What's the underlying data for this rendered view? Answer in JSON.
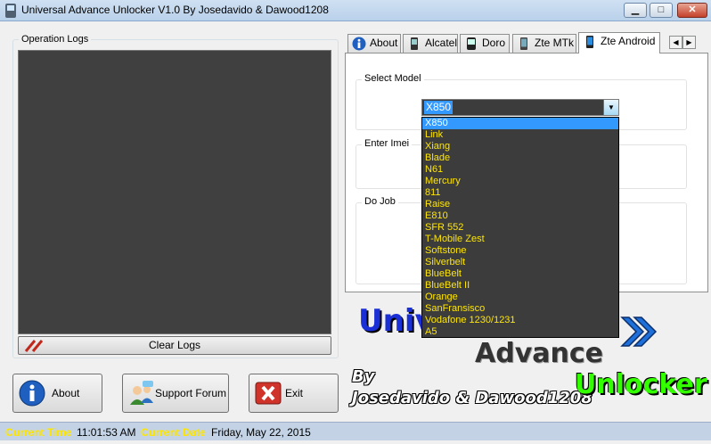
{
  "window": {
    "title": "Universal Advance Unlocker V1.0 By Josedavido & Dawood1208"
  },
  "logs": {
    "group_label": "Operation Logs",
    "clear_label": "Clear Logs"
  },
  "buttons": {
    "about": "About",
    "forum": "Support Forum",
    "exit": "Exit"
  },
  "status": {
    "time_label": "Current Time",
    "time_value": "11:01:53 AM",
    "date_label": "Current Date",
    "date_value": "Friday, May 22, 2015"
  },
  "tabs": [
    {
      "label": "About",
      "icon": "info-icon"
    },
    {
      "label": "Alcatel",
      "icon": "phone-icon"
    },
    {
      "label": "Doro",
      "icon": "phone-icon"
    },
    {
      "label": "Zte MTk",
      "icon": "phone-icon"
    },
    {
      "label": "Zte Android",
      "icon": "phone-icon",
      "active": true
    }
  ],
  "panel": {
    "select_model_label": "Select Model",
    "enter_imei_label": "Enter Imei",
    "do_job_label": "Do Job",
    "model_selected": "X850",
    "model_options": [
      "X850",
      "Link",
      "Xiang",
      "Blade",
      "N61",
      "Mercury",
      "811",
      "Raise",
      "E810",
      "SFR 552",
      "T-Mobile Zest",
      "Softstone",
      "Silverbelt",
      "BlueBelt",
      "BlueBelt II",
      "Orange",
      "SanFransisco",
      "Vodafone 1230/1231",
      "A5"
    ]
  },
  "logo": {
    "word1": "Univer",
    "word2": "Advance",
    "word3": "Unlocker",
    "by": "By",
    "authors": "Josedavido & Dawood1208"
  },
  "colors": {
    "status_label": "#ffe600",
    "dropdown_text": "#ffe600",
    "selection": "#3399ff",
    "unlocker_green": "#33ff00",
    "universal_blue": "#1b2fd6"
  }
}
